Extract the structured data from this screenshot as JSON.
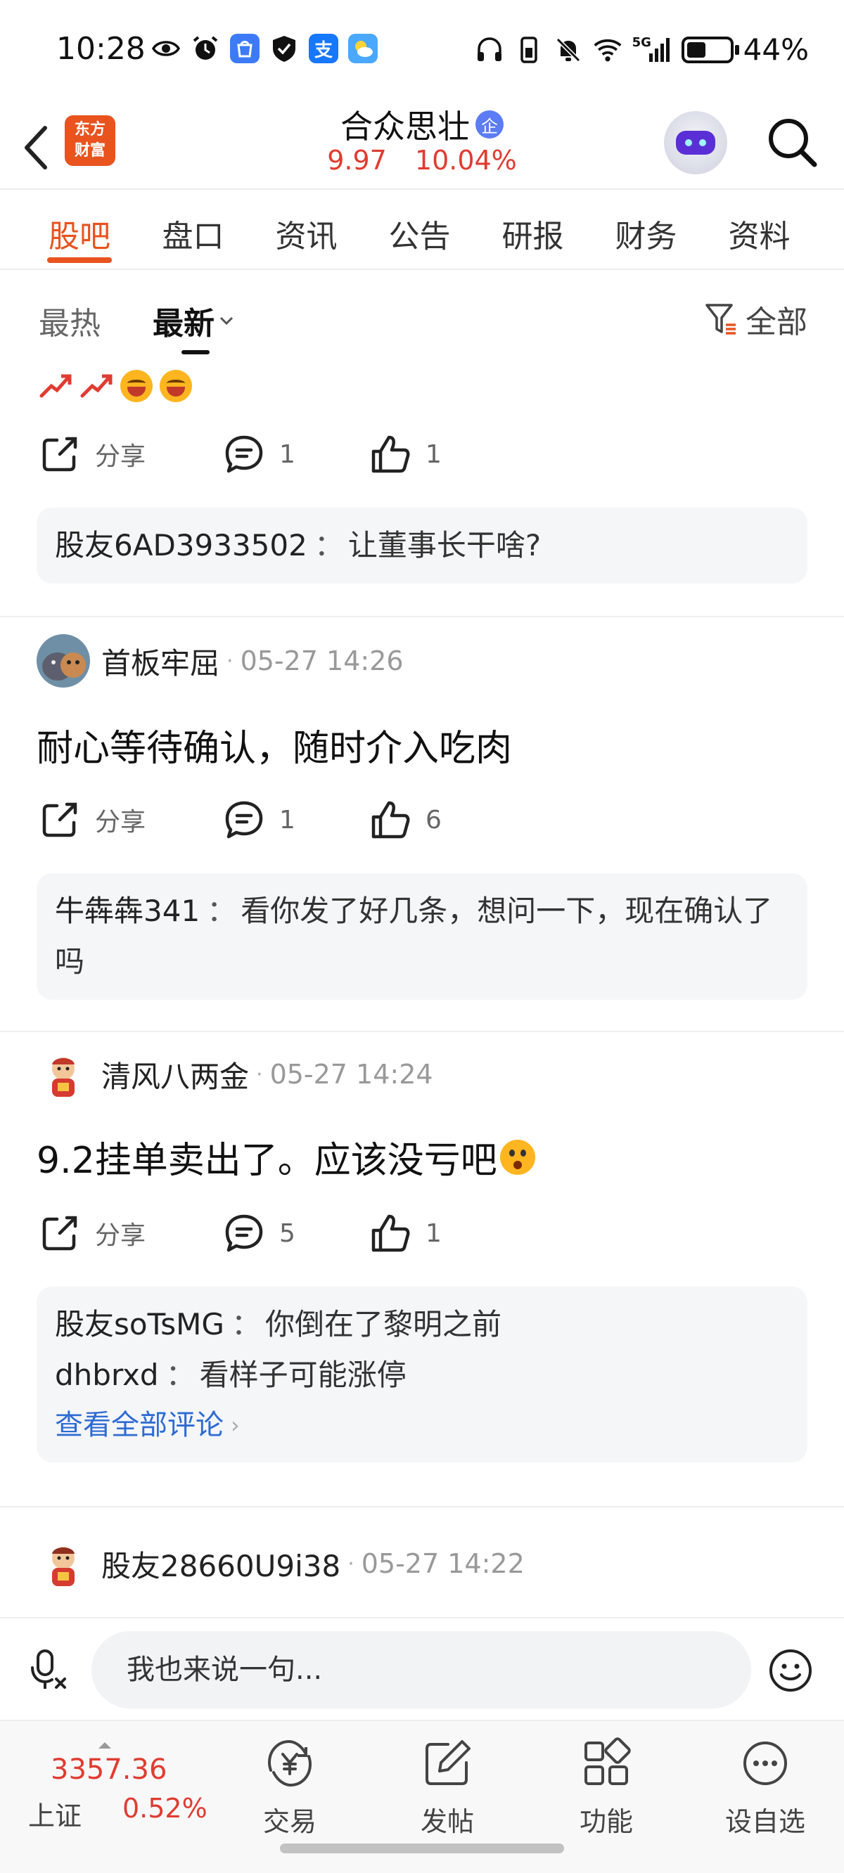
{
  "status_bar": {
    "time": "10:28",
    "battery_text": "44%",
    "battery_level": 0.44,
    "network": "5G",
    "alipay_glyph": "支",
    "left_icons": [
      "eye-icon",
      "alarm-icon",
      "app-store-icon",
      "shield-icon",
      "alipay-icon",
      "weather-icon"
    ],
    "right_icons": [
      "headphones-icon",
      "phone-battery-icon",
      "mute-bell-icon",
      "wifi-icon",
      "signal-5g-icon",
      "battery-icon"
    ]
  },
  "header": {
    "brand_line1": "东方",
    "brand_line2": "财富",
    "stock_name": "合众思壮",
    "verify_badge": "企",
    "price": "9.97",
    "change_pct": "10.04%",
    "accent_color": "#e8531e",
    "up_color": "#e03c31"
  },
  "tabs": [
    {
      "label": "股吧",
      "active": true
    },
    {
      "label": "盘口",
      "active": false
    },
    {
      "label": "资讯",
      "active": false
    },
    {
      "label": "公告",
      "active": false
    },
    {
      "label": "研报",
      "active": false
    },
    {
      "label": "财务",
      "active": false
    },
    {
      "label": "资料",
      "active": false
    }
  ],
  "sort_bar": {
    "hot_label": "最热",
    "new_label": "最新",
    "filter_label": "全部"
  },
  "posts": [
    {
      "text_emojis": [
        "trend-up-icon",
        "trend-up-icon",
        "laughing-emoji",
        "laughing-emoji"
      ],
      "share_label": "分享",
      "comment_count": "1",
      "like_count": "1",
      "comments": [
        {
          "user": "股友6AD3933502",
          "sep": "：",
          "text": "让董事长干啥?"
        }
      ]
    },
    {
      "user": "首板牢屈",
      "dot": "·",
      "time": "05-27 14:26",
      "text": "耐心等待确认，随时介入吃肉",
      "share_label": "分享",
      "comment_count": "1",
      "like_count": "6",
      "comments": [
        {
          "user": "牛犇犇341",
          "sep": "：",
          "text": "看你发了好几条，想问一下，现在确认了吗"
        }
      ]
    },
    {
      "user": "清风八两金",
      "dot": "·",
      "time": "05-27 14:24",
      "text": "9.2挂单卖出了。应该没亏吧",
      "share_label": "分享",
      "comment_count": "5",
      "like_count": "1",
      "comments": [
        {
          "user": "股友soTsMG",
          "sep": "：",
          "text": "你倒在了黎明之前"
        },
        {
          "user": "dhbrxd",
          "sep": "：",
          "text": "看样子可能涨停"
        }
      ],
      "view_all": "查看全部评论"
    },
    {
      "user": "股友28660U9i38",
      "dot": "·",
      "time": "05-27 14:22"
    }
  ],
  "input_bar": {
    "placeholder": "我也来说一句..."
  },
  "bottom_nav": {
    "index_value": "3357.36",
    "index_name": "上证",
    "index_pct": "0.52%",
    "items": [
      {
        "label": "交易",
        "icon": "trade-yen-icon"
      },
      {
        "label": "发帖",
        "icon": "compose-icon"
      },
      {
        "label": "功能",
        "icon": "grid-icon"
      },
      {
        "label": "设自选",
        "icon": "more-dots-icon"
      }
    ]
  }
}
